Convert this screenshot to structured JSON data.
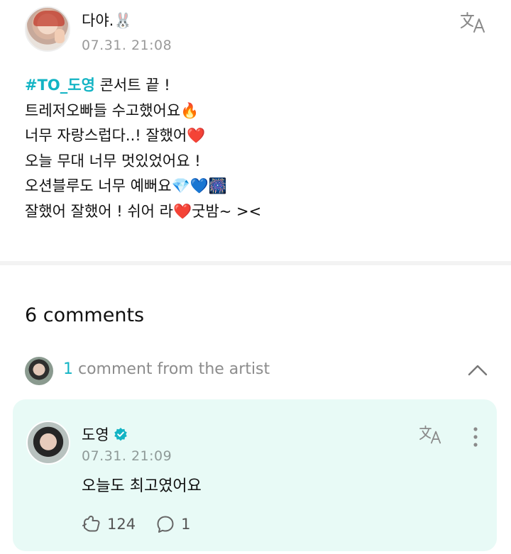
{
  "post": {
    "author": "다야.🐰",
    "time": "07.31. 21:08",
    "hashtag": "#TO_도영",
    "lines": [
      " 콘서트 끝 !",
      "트레저오빠들 수고했어요🔥",
      "너무 자랑스럽다..! 잘했어❤️",
      "오늘 무대 너무 멋있었어요 !",
      "오션블루도 너무 예뻐요💎💙🎆",
      "잘했어 잘했어 !  쉬어 라❤️굿밤~ ><"
    ],
    "translate_icon": "translate-icon"
  },
  "comments": {
    "count_label": "6 comments",
    "artist_count": "1",
    "artist_label": " comment from the artist",
    "collapse_icon": "chevron-up-icon"
  },
  "artist_comment": {
    "name": "도영",
    "verified_icon": "verified-badge-icon",
    "time": "07.31. 21:09",
    "text": "오늘도 최고였어요",
    "likes": "124",
    "replies": "1",
    "like_icon": "like-icon",
    "reply_icon": "reply-bubble-icon",
    "more_icon": "more-vertical-icon"
  },
  "colors": {
    "accent": "#13b4c4",
    "comment_bg": "#e8faf6",
    "muted": "#9a9a9a"
  }
}
